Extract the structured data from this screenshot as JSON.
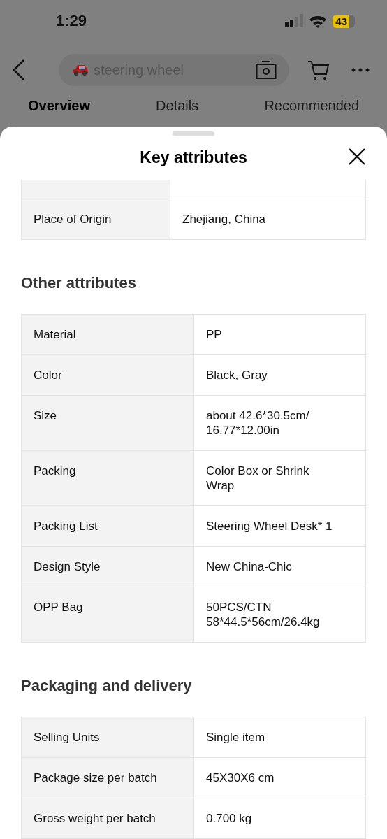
{
  "status_bar": {
    "time": "1:29",
    "battery": "43"
  },
  "nav": {
    "search": {
      "placeholder": "steering wheel"
    }
  },
  "tabs": [
    {
      "label": "Overview",
      "selected": true
    },
    {
      "label": "Details",
      "selected": false
    },
    {
      "label": "Recommended",
      "selected": false
    }
  ],
  "sheet": {
    "title": "Key attributes",
    "sections": [
      {
        "rows": [
          {
            "name": "Place of Origin",
            "value": "Zhejiang, China"
          }
        ]
      },
      {
        "title": "Other attributes",
        "rows": [
          {
            "name": "Material",
            "value": "PP"
          },
          {
            "name": "Color",
            "value": "Black, Gray"
          },
          {
            "name": "Size",
            "value": "about 42.6*30.5cm/\n16.77*12.00in"
          },
          {
            "name": "Packing",
            "value": "Color Box or Shrink\nWrap"
          },
          {
            "name": "Packing List",
            "value": "Steering Wheel Desk* 1"
          },
          {
            "name": "Design Style",
            "value": "New China-Chic"
          },
          {
            "name": "OPP Bag",
            "value": "50PCS/CTN\n58*44.5*56cm/26.4kg"
          }
        ]
      },
      {
        "title": "Packaging and delivery",
        "rows": [
          {
            "name": "Selling Units",
            "value": "Single item"
          },
          {
            "name": "Package size per batch",
            "value": "45X30X6 cm"
          },
          {
            "name": "Gross weight per batch",
            "value": "0.700 kg"
          }
        ]
      }
    ]
  }
}
